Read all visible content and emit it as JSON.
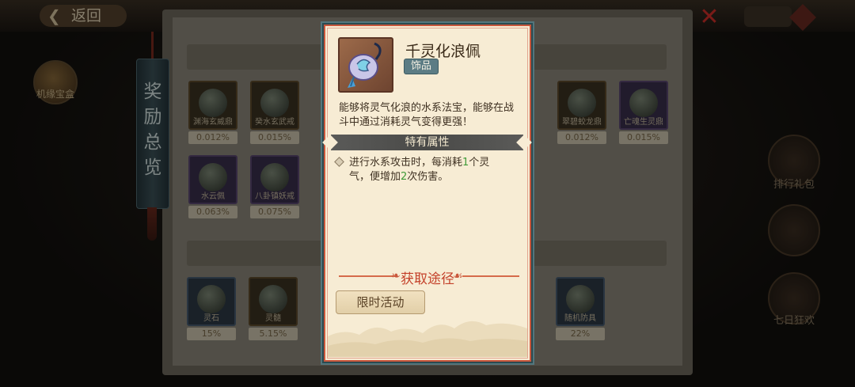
{
  "header": {
    "back_label": "返回",
    "close_label": "✕"
  },
  "left_avatar_label": "机缘宝盒",
  "side_banner_text": "奖励总览",
  "background_items_row1": [
    {
      "name": "渊海玄威鼎",
      "pct": "0.012%"
    },
    {
      "name": "癸水玄武戒",
      "pct": "0.015%"
    },
    {
      "name": "",
      "pct": ""
    },
    {
      "name": "",
      "pct": ""
    },
    {
      "name": "",
      "pct": ""
    },
    {
      "name": "",
      "pct": ""
    },
    {
      "name": "翠碧蛟龙鼎",
      "pct": "0.012%"
    },
    {
      "name": "亡魂生灵鼎",
      "pct": "0.015%"
    }
  ],
  "background_items_row2": [
    {
      "name": "水云佩",
      "pct": "0.063%"
    },
    {
      "name": "八卦镇妖戒",
      "pct": "0.075%"
    }
  ],
  "background_items_row3": [
    {
      "name": "灵石",
      "pct": "15%"
    },
    {
      "name": "灵髓",
      "pct": "5.15%"
    },
    {
      "name": "随机防具",
      "pct": "22%"
    }
  ],
  "right_side_labels": [
    "排行礼包",
    "",
    "七日狂欢"
  ],
  "popup": {
    "item_name": "千灵化浪佩",
    "item_tag": "饰品",
    "description": "能够将灵气化浪的水系法宝，能够在战斗中通过消耗灵气变得更强！",
    "attr_title": "特有属性",
    "attr_text_1": "进行水系攻击时，每消耗",
    "attr_num_1": "1",
    "attr_text_2": "个灵气，便增加",
    "attr_num_2": "2",
    "attr_text_3": "次伤害。",
    "source_title": "获取途径",
    "limited_button": "限时活动"
  },
  "colors": {
    "popup_bg": "#f7ecd4",
    "accent_red": "#c4412a",
    "highlight_green": "#3f9a38",
    "tag_bg": "#5c7c84"
  }
}
